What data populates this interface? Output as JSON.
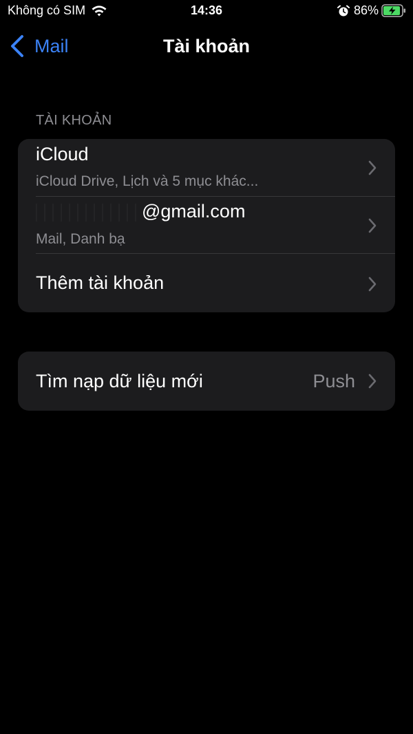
{
  "status_bar": {
    "carrier": "Không có SIM",
    "time": "14:36",
    "battery": "86%",
    "wifi_icon": "wifi-icon",
    "alarm_icon": "alarm-icon",
    "battery_icon": "battery-charging-icon"
  },
  "nav": {
    "back_label": "Mail",
    "title": "Tài khoản"
  },
  "accounts_section": {
    "header": "TÀI KHOẢN",
    "items": [
      {
        "title": "iCloud",
        "subtitle": "iCloud Drive, Lịch và 5 mục khác..."
      },
      {
        "title": "@gmail.com",
        "subtitle": "Mail, Danh bạ"
      },
      {
        "title": "Thêm tài khoản"
      }
    ]
  },
  "fetch_section": {
    "title": "Tìm nạp dữ liệu mới",
    "value": "Push"
  },
  "colors": {
    "background": "#000000",
    "group_background": "#1c1c1e",
    "accent": "#3b82f6",
    "secondary_text": "#8e8e93",
    "battery_green": "#4cd964"
  }
}
